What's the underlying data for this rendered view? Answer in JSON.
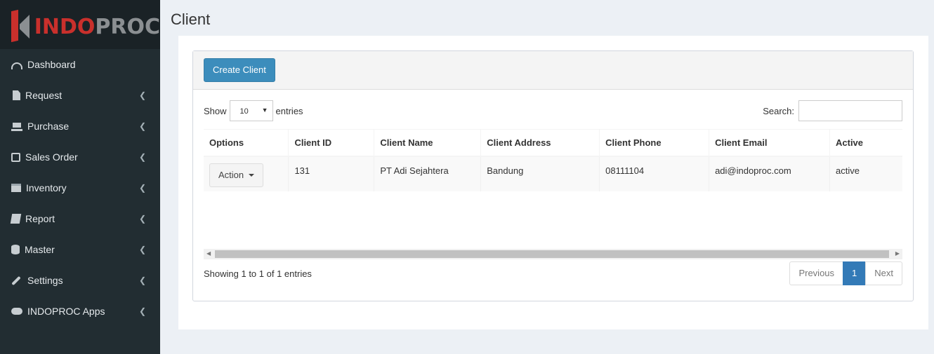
{
  "brand": {
    "prefix": "INDO",
    "suffix": "PROC"
  },
  "sidebar": {
    "items": [
      {
        "label": "Dashboard",
        "icon": "dashboard-icon"
      },
      {
        "label": "Request",
        "icon": "file-icon"
      },
      {
        "label": "Purchase",
        "icon": "cart-icon"
      },
      {
        "label": "Sales Order",
        "icon": "edit-icon"
      },
      {
        "label": "Inventory",
        "icon": "archive-icon"
      },
      {
        "label": "Report",
        "icon": "book-icon"
      },
      {
        "label": "Master",
        "icon": "database-icon"
      },
      {
        "label": "Settings",
        "icon": "wrench-icon"
      },
      {
        "label": "INDOPROC Apps",
        "icon": "cloud-icon"
      }
    ]
  },
  "page": {
    "title": "Client"
  },
  "toolbar": {
    "create_label": "Create Client"
  },
  "table_controls": {
    "show_label": "Show",
    "entries_value": "10",
    "entries_label": "entries",
    "search_label": "Search:",
    "search_value": ""
  },
  "table": {
    "columns": [
      "Options",
      "Client ID",
      "Client Name",
      "Client Address",
      "Client Phone",
      "Client Email",
      "Active"
    ],
    "rows": [
      {
        "action_label": "Action",
        "id": "131",
        "name": "PT Adi Sejahtera",
        "address": "Bandung",
        "phone": "08111104",
        "email": "adi@indoproc.com",
        "active": "active"
      }
    ]
  },
  "footer": {
    "info": "Showing 1 to 1 of 1 entries",
    "previous": "Previous",
    "current_page": "1",
    "next": "Next"
  },
  "colors": {
    "sidebar_bg": "#222d32",
    "primary": "#3c8dbc",
    "brand_red": "#c9302c"
  }
}
